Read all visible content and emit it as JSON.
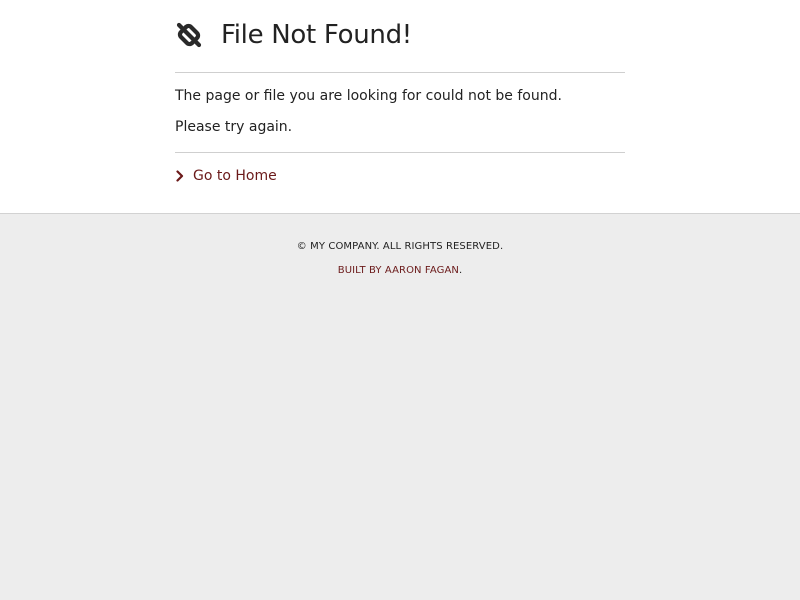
{
  "page": {
    "title": "File Not Found!",
    "message_line1": "The page or file you are looking for could not be found.",
    "message_line2": "Please try again.",
    "home_link_label": "Go to Home"
  },
  "footer": {
    "copyright": "© MY COMPANY. ALL RIGHTS RESERVED.",
    "built_by": "BUILT BY AARON FAGAN",
    "built_by_suffix": "."
  },
  "colors": {
    "accent": "#6b1a1a",
    "background": "#ededed",
    "surface": "#ffffff",
    "text": "#222222",
    "divider": "#cfcfcf"
  },
  "icons": {
    "logo": "broken-link-icon",
    "home_link": "chevron-right-icon"
  }
}
